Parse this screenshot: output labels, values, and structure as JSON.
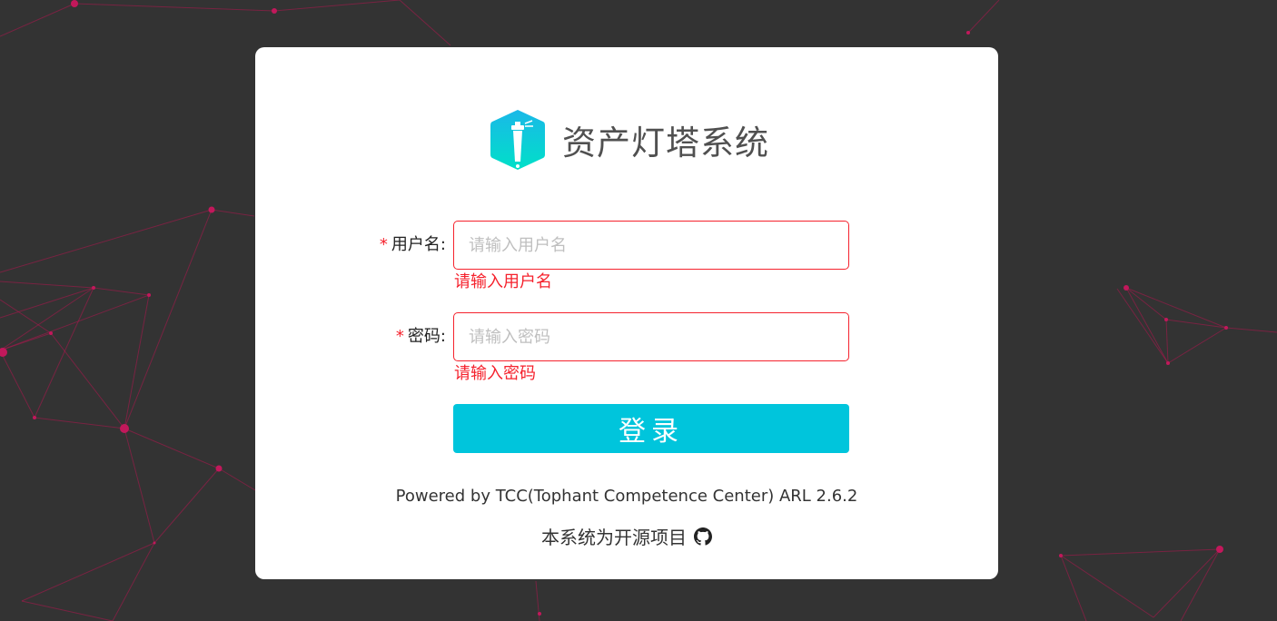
{
  "app": {
    "title": "资产灯塔系统"
  },
  "form": {
    "username": {
      "label": "用户名",
      "required_mark": "*",
      "separator": ":",
      "placeholder": "请输入用户名",
      "value": "",
      "error": "请输入用户名"
    },
    "password": {
      "label": "密码",
      "required_mark": "*",
      "separator": ":",
      "placeholder": "请输入密码",
      "value": "",
      "error": "请输入密码"
    },
    "submit_label": "登录"
  },
  "footer": {
    "powered_by": "Powered by TCC(Tophant Competence Center) ARL 2.6.2",
    "open_source": "本系统为开源项目",
    "github_icon": "github-icon"
  },
  "colors": {
    "page_background": "#333333",
    "network_lines": "#c2185b",
    "card_background": "#ffffff",
    "primary_button": "#00c5dc",
    "error": "#f5222d",
    "logo_gradient_top": "#1ab8e8",
    "logo_gradient_bottom": "#00e0c8"
  }
}
